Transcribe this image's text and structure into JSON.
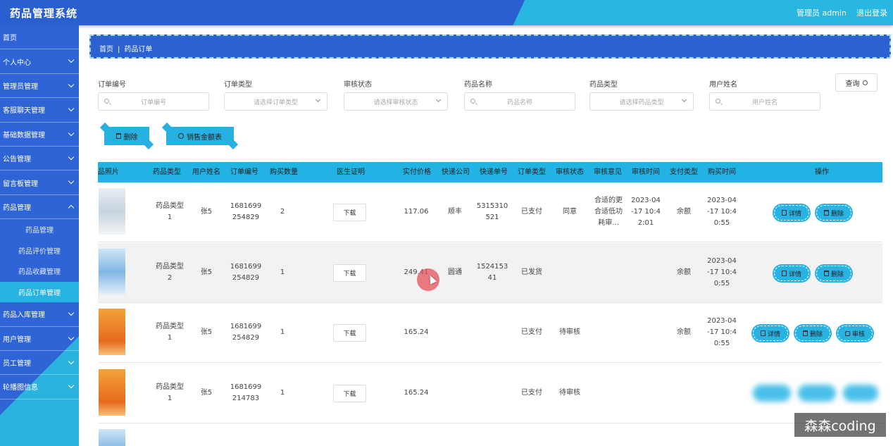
{
  "app": {
    "title": "药品管理系统",
    "user": "管理员 admin",
    "logout": "退出登录"
  },
  "sidebar": {
    "items": [
      {
        "label": "首页"
      },
      {
        "label": "个人中心"
      },
      {
        "label": "管理员管理"
      },
      {
        "label": "客服聊天管理"
      },
      {
        "label": "基础数据管理"
      },
      {
        "label": "公告管理"
      },
      {
        "label": "留言板管理"
      },
      {
        "label": "药品管理"
      }
    ],
    "subitems": [
      {
        "label": "药品管理"
      },
      {
        "label": "药品评价管理"
      },
      {
        "label": "药品收藏管理"
      },
      {
        "label": "药品订单管理"
      }
    ],
    "items_after": [
      {
        "label": "药品入库管理"
      },
      {
        "label": "用户管理"
      },
      {
        "label": "员工管理"
      },
      {
        "label": "轮播图信息"
      }
    ]
  },
  "breadcrumb": {
    "home": "首页",
    "sep": "|",
    "current": "药品订单"
  },
  "search": {
    "fields": [
      {
        "label": "订单编号",
        "placeholder": "订单编号"
      },
      {
        "label": "订单类型",
        "placeholder": "请选择订单类型"
      },
      {
        "label": "审核状态",
        "placeholder": "请选择审核状态"
      },
      {
        "label": "药品名称",
        "placeholder": "药品名称"
      },
      {
        "label": "药品类型",
        "placeholder": "请选择药品类型"
      },
      {
        "label": "用户姓名",
        "placeholder": "用户姓名"
      }
    ],
    "query_label": "查询"
  },
  "actions": {
    "delete_label": "删除",
    "report_label": "销售金额表"
  },
  "table": {
    "headers": [
      "品照片",
      "药品类型",
      "用户姓名",
      "订单编号",
      "购买数量",
      "医生证明",
      "实付价格",
      "快递公司",
      "快递单号",
      "订单类型",
      "审核状态",
      "审核意见",
      "审核时间",
      "支付类型",
      "购买时间",
      "操作"
    ],
    "download_label": "下载",
    "ops": {
      "detail": "详情",
      "delete": "删除",
      "audit": "审核"
    },
    "rows": [
      {
        "type": "药品类型\n1",
        "user": "张5",
        "order_no": "1681699\n254829",
        "qty": "2",
        "price": "117.06",
        "courier": "顺丰",
        "tracking": "5315310\n521",
        "order_type": "已支付",
        "audit_status": "同意",
        "audit_opinion": "合适的更\n合适低功\n耗审...",
        "audit_time": "2023-04\n-17 10:4\n2:01",
        "pay_type": "余额",
        "buy_time": "2023-04\n-17 10:4\n0:55"
      },
      {
        "type": "药品类型\n2",
        "user": "张5",
        "order_no": "1681699\n254829",
        "qty": "1",
        "price": "249.41",
        "courier": "圆通",
        "tracking": "1524153\n41",
        "order_type": "已发货",
        "audit_status": "",
        "audit_opinion": "",
        "audit_time": "",
        "pay_type": "余额",
        "buy_time": "2023-04\n-17 10:4\n0:55"
      },
      {
        "type": "药品类型\n1",
        "user": "张5",
        "order_no": "1681699\n254829",
        "qty": "1",
        "price": "165.24",
        "courier": "",
        "tracking": "",
        "order_type": "已支付",
        "audit_status": "待审核",
        "audit_opinion": "",
        "audit_time": "",
        "pay_type": "余额",
        "buy_time": "2023-04\n-17 10:4\n0:55"
      },
      {
        "type": "药品类型\n1",
        "user": "张5",
        "order_no": "1681699\n214783",
        "qty": "1",
        "price": "165.24",
        "courier": "",
        "tracking": "",
        "order_type": "已支付",
        "audit_status": "待审核",
        "audit_opinion": "",
        "audit_time": "",
        "pay_type": "",
        "buy_time": ""
      }
    ]
  },
  "watermark": "森森coding"
}
